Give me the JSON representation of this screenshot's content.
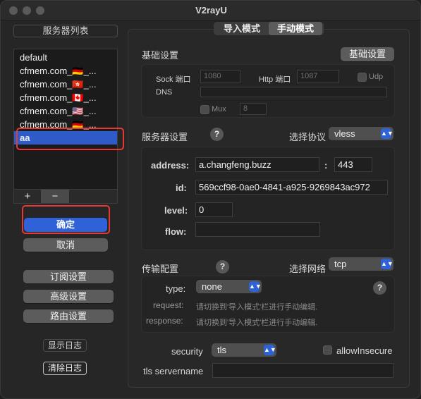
{
  "window": {
    "title": "V2rayU"
  },
  "sidebar": {
    "header": "服务器列表",
    "servers": [
      {
        "label": "default"
      },
      {
        "label": "cfmem.com_🇩🇪_..."
      },
      {
        "label": "cfmem.com_🇭🇰_..."
      },
      {
        "label": "cfmem.com_🇨🇦_..."
      },
      {
        "label": "cfmem.com_🇺🇸_..."
      },
      {
        "label": "cfmem.com_🇩🇪_..."
      },
      {
        "label": "aa"
      }
    ],
    "selected_index": 6,
    "add_label": "+",
    "remove_label": "−",
    "confirm_label": "确定",
    "cancel_label": "取消",
    "subscribe_label": "订阅设置",
    "advanced_label": "高级设置",
    "routing_label": "路由设置",
    "show_log_label": "显示日志",
    "clear_log_label": "清除日志"
  },
  "mode_tabs": {
    "import_label": "导入模式",
    "manual_label": "手动模式",
    "active": "manual"
  },
  "basic": {
    "section_label": "基础设置",
    "button_label": "基础设置",
    "sock_port_label": "Sock 端口",
    "sock_port_value": "1080",
    "http_port_label": "Http 端口",
    "http_port_value": "1087",
    "udp_label": "Udp",
    "dns_label": "DNS",
    "dns_value": "",
    "mux_label": "Mux",
    "mux_value": "8"
  },
  "server": {
    "section_label": "服务器设置",
    "protocol_label": "选择协议",
    "protocol_value": "vless",
    "address_label": "address:",
    "address_value": "a.changfeng.buzz",
    "colon": ":",
    "port_value": "443",
    "id_label": "id:",
    "id_value": "569ccf98-0ae0-4841-a925-9269843ac972",
    "level_label": "level:",
    "level_value": "0",
    "flow_label": "flow:",
    "flow_value": ""
  },
  "transport": {
    "section_label": "传输配置",
    "network_label": "选择网络",
    "network_value": "tcp",
    "type_label": "type:",
    "type_value": "none",
    "request_label": "request:",
    "request_hint": "请切换到'导入模式'栏进行手动编辑.",
    "response_label": "response:",
    "response_hint": "请切换到'导入模式'栏进行手动编辑."
  },
  "security": {
    "label": "security",
    "value": "tls",
    "allow_insecure_label": "allowInsecure",
    "servername_label": "tls servername",
    "servername_value": ""
  },
  "help_glyph": "?",
  "chevron_glyph": "⌃⌄",
  "colors": {
    "accent": "#2f62d6",
    "highlight_frame": "#e53935",
    "selected_row": "#2f5bc8"
  }
}
